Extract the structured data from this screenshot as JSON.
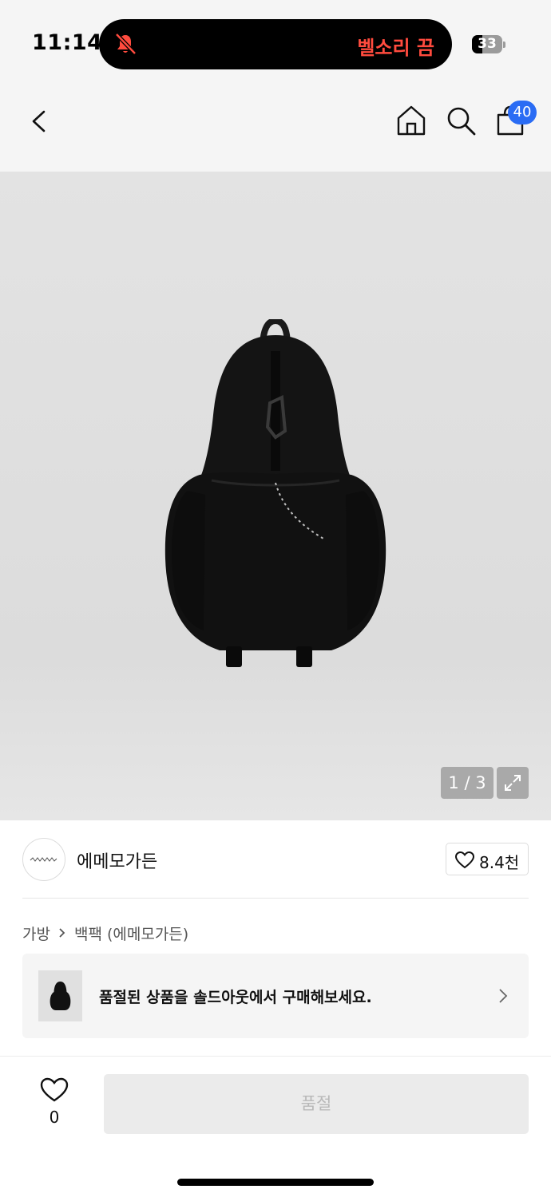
{
  "status_bar": {
    "time": "11:14",
    "silent_mode_label": "벨소리 끔",
    "battery_level": "33",
    "battery_fraction": 0.33
  },
  "nav": {
    "cart_count": "40",
    "icons": [
      "back-icon",
      "home-icon",
      "search-icon",
      "cart-icon"
    ]
  },
  "gallery": {
    "counter": "1 / 3",
    "icons": [
      "expand-icon"
    ]
  },
  "brand": {
    "name": "에메모가든",
    "like_count": "8.4천"
  },
  "breadcrumb": {
    "items": [
      "가방",
      "백팩 (에메모가든)"
    ]
  },
  "soldout_banner": {
    "text": "품절된 상품을 솔드아웃에서 구매해보세요."
  },
  "bottom_bar": {
    "like_count": "0",
    "buy_label": "품절"
  },
  "colors": {
    "accent_blue": "#2a6cf4",
    "silent_red": "#ff4b3e",
    "disabled_text": "#b8b8b8"
  }
}
